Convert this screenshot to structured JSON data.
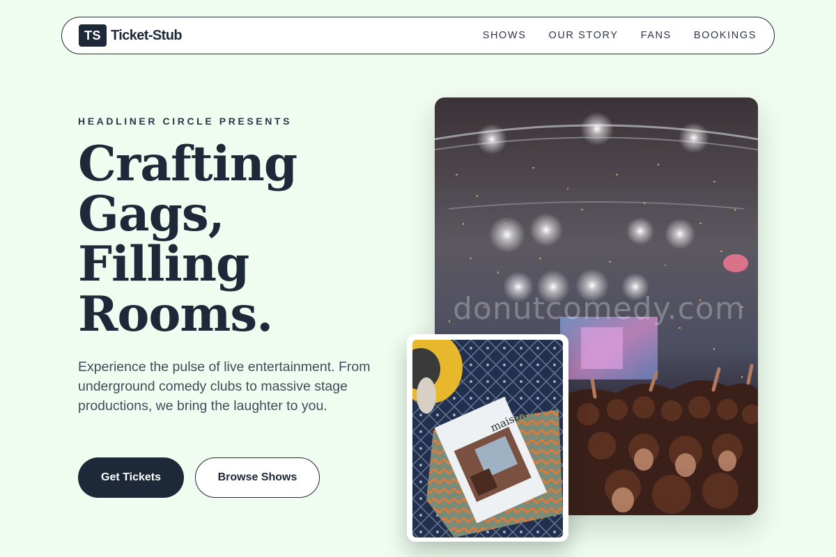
{
  "nav": {
    "brand_mark": "TS",
    "brand_name": "Ticket-Stub",
    "links": [
      "SHOWS",
      "OUR STORY",
      "FANS",
      "BOOKINGS"
    ]
  },
  "hero": {
    "eyebrow": "HEADLINER CIRCLE PRESENTS",
    "headline": [
      "Crafting",
      "Gags,",
      "Filling",
      "Rooms."
    ],
    "lede": "Experience the pulse of live entertainment. From underground comedy clubs to massive stage productions, we bring the laughter to you.",
    "primary_cta": "Get Tickets",
    "secondary_cta": "Browse Shows"
  },
  "media": {
    "concert_watermark": "donutcomedy.com",
    "magazine_title": "maison"
  },
  "colors": {
    "background": "#effcef",
    "navy": "#1d2838",
    "text_muted": "#414b5a"
  }
}
